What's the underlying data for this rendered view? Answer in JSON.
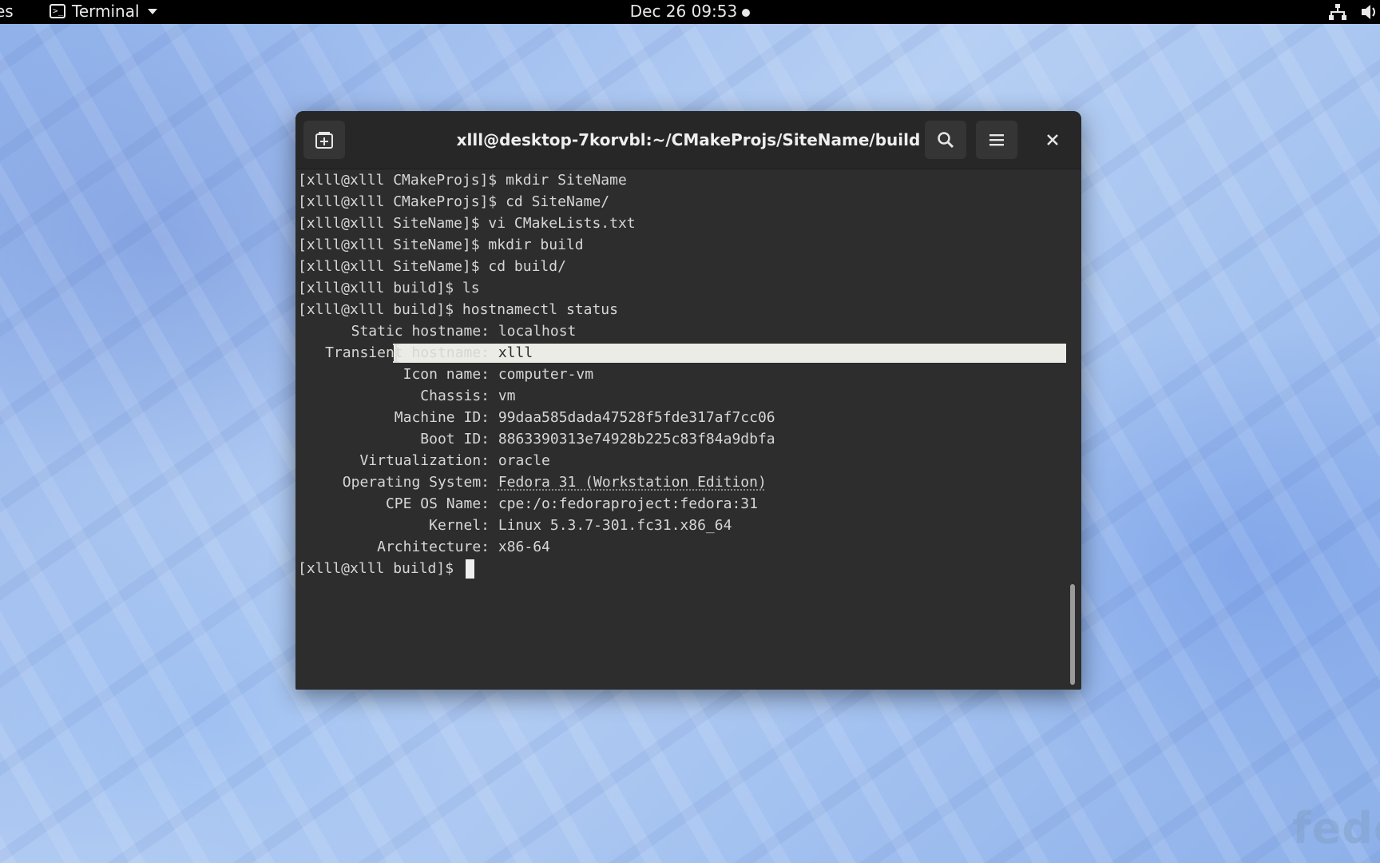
{
  "topbar": {
    "activities": "es",
    "app_name": "Terminal",
    "clock": "Dec 26  09:53"
  },
  "window": {
    "title": "xlll@desktop-7korvbl:~/CMakeProjs/SiteName/build",
    "lines": [
      "[xlll@xlll CMakeProjs]$ mkdir SiteName",
      "[xlll@xlll CMakeProjs]$ cd SiteName/",
      "[xlll@xlll SiteName]$ vi CMakeLists.txt",
      "[xlll@xlll SiteName]$ mkdir build",
      "[xlll@xlll SiteName]$ cd build/",
      "[xlll@xlll build]$ ls",
      "[xlll@xlll build]$ hostnamectl status"
    ],
    "status": [
      {
        "key": "Static hostname:",
        "value": "localhost"
      },
      {
        "key": "Transient hostname:",
        "value": "xlll"
      },
      {
        "key": "Icon name:",
        "value": "computer-vm"
      },
      {
        "key": "Chassis:",
        "value": "vm"
      },
      {
        "key": "Machine ID:",
        "value": "99daa585dada47528f5fde317af7cc06"
      },
      {
        "key": "Boot ID:",
        "value": "8863390313e74928b225c83f84a9dbfa"
      },
      {
        "key": "Virtualization:",
        "value": "oracle"
      },
      {
        "key": "Operating System:",
        "value": "Fedora 31 (Workstation Edition)"
      },
      {
        "key": "CPE OS Name:",
        "value": "cpe:/o:fedoraproject:fedora:31"
      },
      {
        "key": "Kernel:",
        "value": "Linux 5.3.7-301.fc31.x86_64"
      },
      {
        "key": "Architecture:",
        "value": "x86-64"
      }
    ],
    "prompt": "[xlll@xlll build]$"
  },
  "desktop": {
    "watermark": "fedo"
  },
  "icons": {
    "new_tab": "new-tab-icon",
    "search": "search-icon",
    "menu": "hamburger-menu-icon",
    "close": "close-icon"
  }
}
